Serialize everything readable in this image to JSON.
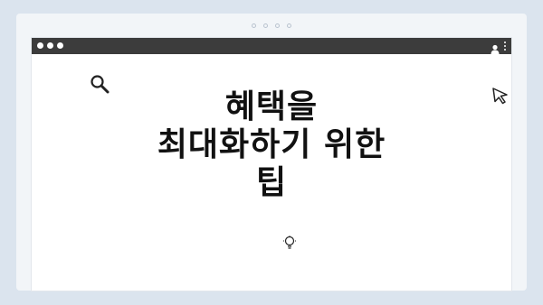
{
  "title": {
    "line1": "혜택을",
    "line2": "최대화하기 위한",
    "line3": "팁"
  },
  "icons": {
    "top_dots": "pagination-dots-icon",
    "traffic_lights": "window-controls-icon",
    "user": "user-icon",
    "menu": "kebab-menu-icon",
    "search": "search-icon",
    "cursor": "cursor-arrow-icon",
    "bulb": "lightbulb-icon"
  },
  "colors": {
    "background": "#dbe4ee",
    "titlebar": "#3c3c3c",
    "text": "#111111"
  }
}
